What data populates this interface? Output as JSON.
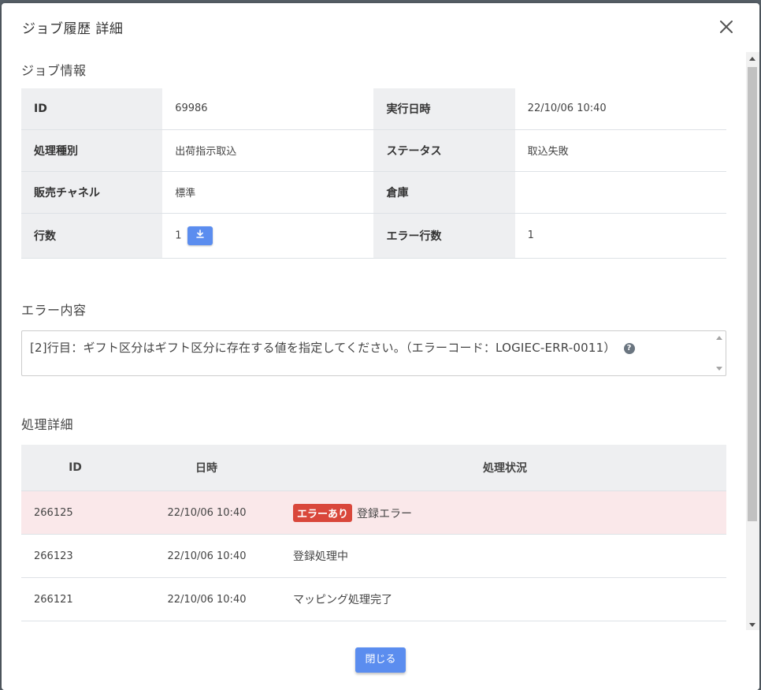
{
  "modal": {
    "title": "ジョブ履歴 詳細"
  },
  "job_info": {
    "section_title": "ジョブ情報",
    "rows": [
      {
        "l1": "ID",
        "v1": "69986",
        "l2": "実行日時",
        "v2": "22/10/06 10:40"
      },
      {
        "l1": "処理種別",
        "v1": "出荷指示取込",
        "l2": "ステータス",
        "v2": "取込失敗"
      },
      {
        "l1": "販売チャネル",
        "v1": "標準",
        "l2": "倉庫",
        "v2": ""
      },
      {
        "l1": "行数",
        "v1": "1",
        "l2": "エラー行数",
        "v2": "1"
      }
    ]
  },
  "error": {
    "section_title": "エラー内容",
    "message": "[2]行目：ギフト区分はギフト区分に存在する値を指定してください。（エラーコード：LOGIEC-ERR-0011）",
    "help_icon": "?"
  },
  "detail": {
    "section_title": "処理詳細",
    "headers": {
      "id": "ID",
      "datetime": "日時",
      "status": "処理状況"
    },
    "rows": [
      {
        "id": "266125",
        "datetime": "22/10/06 10:40",
        "badge": "エラーあり",
        "status": "登録エラー"
      },
      {
        "id": "266123",
        "datetime": "22/10/06 10:40",
        "status": "登録処理中"
      },
      {
        "id": "266121",
        "datetime": "22/10/06 10:40",
        "status": "マッピング処理完了"
      }
    ]
  },
  "footer": {
    "close_label": "閉じる"
  },
  "colors": {
    "primary": "#5b8def",
    "error_badge": "#d9473b",
    "error_row": "#fae8ea"
  }
}
